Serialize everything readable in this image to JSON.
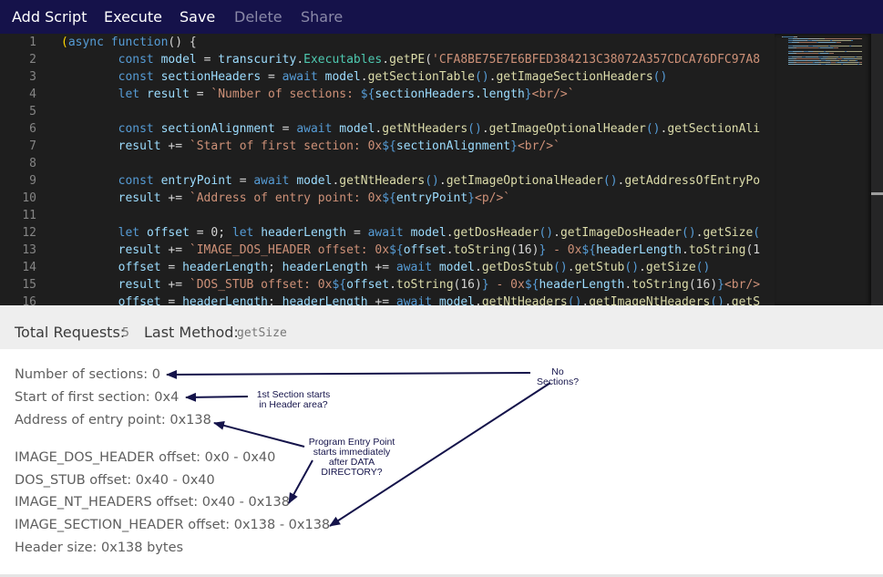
{
  "toolbar": {
    "add_script": "Add Script",
    "execute": "Execute",
    "save": "Save",
    "delete": "Delete",
    "share": "Share"
  },
  "editor": {
    "lines": [
      {
        "n": "1",
        "tokens": [
          [
            "(",
            "y"
          ],
          [
            "async ",
            "k"
          ],
          [
            "function",
            "k"
          ],
          [
            "() {",
            "d"
          ]
        ]
      },
      {
        "n": "2",
        "tokens": [
          [
            "        ",
            "d"
          ],
          [
            "const ",
            "k"
          ],
          [
            "model ",
            "v"
          ],
          [
            "= ",
            "d"
          ],
          [
            "transcurity",
            "v"
          ],
          [
            ".",
            "d"
          ],
          [
            "Executables",
            "t"
          ],
          [
            ".",
            "d"
          ],
          [
            "getPE",
            "f"
          ],
          [
            "(",
            "d"
          ],
          [
            "'CFA8BE75E7E6BFED384213C38072A357CDCA76DFC97A8",
            "s"
          ]
        ]
      },
      {
        "n": "3",
        "tokens": [
          [
            "        ",
            "d"
          ],
          [
            "const ",
            "k"
          ],
          [
            "sectionHeaders ",
            "v"
          ],
          [
            "= ",
            "d"
          ],
          [
            "await ",
            "k"
          ],
          [
            "model",
            "v"
          ],
          [
            ".",
            "d"
          ],
          [
            "getSectionTable",
            "f"
          ],
          [
            "()",
            "k"
          ],
          [
            ".",
            "d"
          ],
          [
            "getImageSectionHeaders",
            "f"
          ],
          [
            "()",
            "k"
          ]
        ]
      },
      {
        "n": "4",
        "tokens": [
          [
            "        ",
            "d"
          ],
          [
            "let ",
            "k"
          ],
          [
            "result ",
            "v"
          ],
          [
            "= ",
            "d"
          ],
          [
            "`Number of sections: ",
            "s"
          ],
          [
            "${",
            "k"
          ],
          [
            "sectionHeaders.length",
            "v"
          ],
          [
            "}",
            "k"
          ],
          [
            "<br/>`",
            "s"
          ]
        ]
      },
      {
        "n": "5",
        "tokens": []
      },
      {
        "n": "6",
        "tokens": [
          [
            "        ",
            "d"
          ],
          [
            "const ",
            "k"
          ],
          [
            "sectionAlignment ",
            "v"
          ],
          [
            "= ",
            "d"
          ],
          [
            "await ",
            "k"
          ],
          [
            "model",
            "v"
          ],
          [
            ".",
            "d"
          ],
          [
            "getNtHeaders",
            "f"
          ],
          [
            "()",
            "k"
          ],
          [
            ".",
            "d"
          ],
          [
            "getImageOptionalHeader",
            "f"
          ],
          [
            "()",
            "k"
          ],
          [
            ".",
            "d"
          ],
          [
            "getSectionAli",
            "f"
          ]
        ]
      },
      {
        "n": "7",
        "tokens": [
          [
            "        ",
            "d"
          ],
          [
            "result ",
            "v"
          ],
          [
            "+= ",
            "d"
          ],
          [
            "`Start of first section: 0x",
            "s"
          ],
          [
            "${",
            "k"
          ],
          [
            "sectionAlignment",
            "v"
          ],
          [
            "}",
            "k"
          ],
          [
            "<br/>`",
            "s"
          ]
        ]
      },
      {
        "n": "8",
        "tokens": []
      },
      {
        "n": "9",
        "tokens": [
          [
            "        ",
            "d"
          ],
          [
            "const ",
            "k"
          ],
          [
            "entryPoint ",
            "v"
          ],
          [
            "= ",
            "d"
          ],
          [
            "await ",
            "k"
          ],
          [
            "model",
            "v"
          ],
          [
            ".",
            "d"
          ],
          [
            "getNtHeaders",
            "f"
          ],
          [
            "()",
            "k"
          ],
          [
            ".",
            "d"
          ],
          [
            "getImageOptionalHeader",
            "f"
          ],
          [
            "()",
            "k"
          ],
          [
            ".",
            "d"
          ],
          [
            "getAddressOfEntryPo",
            "f"
          ]
        ]
      },
      {
        "n": "10",
        "tokens": [
          [
            "        ",
            "d"
          ],
          [
            "result ",
            "v"
          ],
          [
            "+= ",
            "d"
          ],
          [
            "`Address of entry point: 0x",
            "s"
          ],
          [
            "${",
            "k"
          ],
          [
            "entryPoint",
            "v"
          ],
          [
            "}",
            "k"
          ],
          [
            "<p/>`",
            "s"
          ]
        ]
      },
      {
        "n": "11",
        "tokens": []
      },
      {
        "n": "12",
        "tokens": [
          [
            "        ",
            "d"
          ],
          [
            "let ",
            "k"
          ],
          [
            "offset ",
            "v"
          ],
          [
            "= 0; ",
            "d"
          ],
          [
            "let ",
            "k"
          ],
          [
            "headerLength ",
            "v"
          ],
          [
            "= ",
            "d"
          ],
          [
            "await ",
            "k"
          ],
          [
            "model",
            "v"
          ],
          [
            ".",
            "d"
          ],
          [
            "getDosHeader",
            "f"
          ],
          [
            "()",
            "k"
          ],
          [
            ".",
            "d"
          ],
          [
            "getImageDosHeader",
            "f"
          ],
          [
            "()",
            "k"
          ],
          [
            ".",
            "d"
          ],
          [
            "getSize",
            "f"
          ],
          [
            "(",
            "k"
          ]
        ]
      },
      {
        "n": "13",
        "tokens": [
          [
            "        ",
            "d"
          ],
          [
            "result ",
            "v"
          ],
          [
            "+= ",
            "d"
          ],
          [
            "`IMAGE_DOS_HEADER offset: 0x",
            "s"
          ],
          [
            "${",
            "k"
          ],
          [
            "offset",
            "v"
          ],
          [
            ".",
            "d"
          ],
          [
            "toString",
            "f"
          ],
          [
            "(16)",
            "d"
          ],
          [
            "}",
            "k"
          ],
          [
            " - 0x",
            "s"
          ],
          [
            "${",
            "k"
          ],
          [
            "headerLength",
            "v"
          ],
          [
            ".",
            "d"
          ],
          [
            "toString",
            "f"
          ],
          [
            "(1",
            "d"
          ]
        ]
      },
      {
        "n": "14",
        "tokens": [
          [
            "        ",
            "d"
          ],
          [
            "offset ",
            "v"
          ],
          [
            "= ",
            "d"
          ],
          [
            "headerLength",
            "v"
          ],
          [
            "; ",
            "d"
          ],
          [
            "headerLength ",
            "v"
          ],
          [
            "+= ",
            "d"
          ],
          [
            "await ",
            "k"
          ],
          [
            "model",
            "v"
          ],
          [
            ".",
            "d"
          ],
          [
            "getDosStub",
            "f"
          ],
          [
            "()",
            "k"
          ],
          [
            ".",
            "d"
          ],
          [
            "getStub",
            "f"
          ],
          [
            "()",
            "k"
          ],
          [
            ".",
            "d"
          ],
          [
            "getSize",
            "f"
          ],
          [
            "()",
            "k"
          ]
        ]
      },
      {
        "n": "15",
        "tokens": [
          [
            "        ",
            "d"
          ],
          [
            "result ",
            "v"
          ],
          [
            "+= ",
            "d"
          ],
          [
            "`DOS_STUB offset: 0x",
            "s"
          ],
          [
            "${",
            "k"
          ],
          [
            "offset",
            "v"
          ],
          [
            ".",
            "d"
          ],
          [
            "toString",
            "f"
          ],
          [
            "(16)",
            "d"
          ],
          [
            "}",
            "k"
          ],
          [
            " - 0x",
            "s"
          ],
          [
            "${",
            "k"
          ],
          [
            "headerLength",
            "v"
          ],
          [
            ".",
            "d"
          ],
          [
            "toString",
            "f"
          ],
          [
            "(16)",
            "d"
          ],
          [
            "}",
            "k"
          ],
          [
            "<br/>",
            "s"
          ]
        ]
      },
      {
        "n": "16",
        "tokens": [
          [
            "        ",
            "d"
          ],
          [
            "offset ",
            "v"
          ],
          [
            "= ",
            "d"
          ],
          [
            "headerLength",
            "v"
          ],
          [
            "; ",
            "d"
          ],
          [
            "headerLength ",
            "v"
          ],
          [
            "+= ",
            "d"
          ],
          [
            "await ",
            "k"
          ],
          [
            "model",
            "v"
          ],
          [
            ".",
            "d"
          ],
          [
            "getNtHeaders",
            "f"
          ],
          [
            "()",
            "k"
          ],
          [
            ".",
            "d"
          ],
          [
            "getImageNtHeaders",
            "f"
          ],
          [
            "()",
            "k"
          ],
          [
            ".",
            "d"
          ],
          [
            "getS",
            "f"
          ]
        ]
      }
    ]
  },
  "stats": {
    "total_label": "Total Requests:",
    "total_value": "5",
    "method_label": "Last Method:",
    "method_value": "getSize"
  },
  "output": {
    "number_of_sections": "Number of sections: 0",
    "start_of_first_section": "Start of first section: 0x4",
    "address_of_entry_point": "Address of entry point: 0x138",
    "image_dos_header": "IMAGE_DOS_HEADER offset: 0x0 - 0x40",
    "dos_stub": "DOS_STUB offset: 0x40 - 0x40",
    "image_nt_headers": "IMAGE_NT_HEADERS offset: 0x40 - 0x138",
    "image_section_header": "IMAGE_SECTION_HEADER offset: 0x138 - 0x138",
    "header_size": "Header size: 0x138 bytes"
  },
  "annotations": {
    "no_sections": [
      "No",
      "Sections?"
    ],
    "first_section": [
      "1st Section starts",
      "in Header area?"
    ],
    "entry_point": [
      "Program Entry Point",
      "starts immediately",
      "after DATA",
      "DIRECTORY?"
    ]
  },
  "colors": {
    "navbar": "#15124a",
    "editor_bg": "#1e1e1e",
    "annotation": "#14134a"
  }
}
